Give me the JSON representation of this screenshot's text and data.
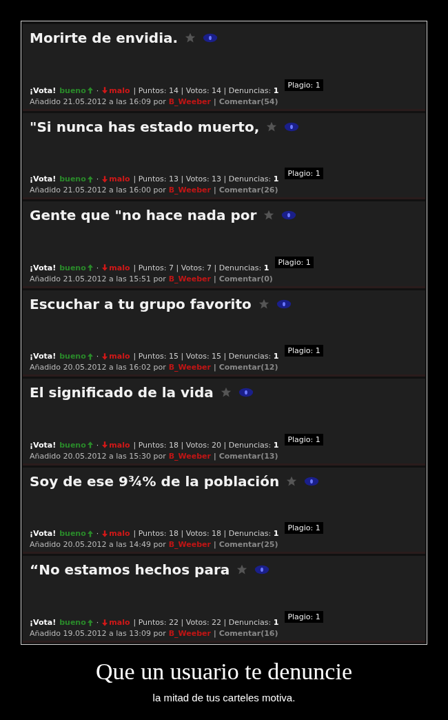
{
  "posts": [
    {
      "title": "Morirte de envidia.",
      "vote_label": "¡Vota!",
      "good": "bueno",
      "dot": "·",
      "bad": "malo",
      "stats": "| Puntos: 14 | Votos: 14 | Denuncias: **1**",
      "plagio": "Plagio: 1",
      "added": "Añadido 21.05.2012 a las 16:09 por",
      "author": "B_Weeber",
      "sep": "|",
      "comments": "Comentar(54)"
    },
    {
      "title": "\"Si nunca has estado muerto,",
      "vote_label": "¡Vota!",
      "good": "bueno",
      "dot": "·",
      "bad": "malo",
      "stats": "| Puntos: 13 | Votos: 13 | Denuncias: **1**",
      "plagio": "Plagio: 1",
      "added": "Añadido 21.05.2012 a las 16:00 por",
      "author": "B_Weeber",
      "sep": "|",
      "comments": "Comentar(26)"
    },
    {
      "title": "Gente que \"no hace nada por",
      "vote_label": "¡Vota!",
      "good": "bueno",
      "dot": "·",
      "bad": "malo",
      "stats": "| Puntos: 7 | Votos: 7 | Denuncias: **1**",
      "plagio": "Plagio: 1",
      "added": "Añadido 21.05.2012 a las 15:51 por",
      "author": "B_Weeber",
      "sep": "|",
      "comments": "Comentar(0)"
    },
    {
      "title": "Escuchar a tu grupo favorito",
      "vote_label": "¡Vota!",
      "good": "bueno",
      "dot": "·",
      "bad": "malo",
      "stats": "| Puntos: 15 | Votos: 15 | Denuncias: **1**",
      "plagio": "Plagio: 1",
      "added": "Añadido 20.05.2012 a las 16:02 por",
      "author": "B_Weeber",
      "sep": "|",
      "comments": "Comentar(12)"
    },
    {
      "title": "El significado de la vida",
      "vote_label": "¡Vota!",
      "good": "bueno",
      "dot": "·",
      "bad": "malo",
      "stats": "| Puntos: 18 | Votos: 20 | Denuncias: **1**",
      "plagio": "Plagio: 1",
      "added": "Añadido 20.05.2012 a las 15:30 por",
      "author": "B_Weeber",
      "sep": "|",
      "comments": "Comentar(13)"
    },
    {
      "title": "Soy de ese 9¾% de la población",
      "vote_label": "¡Vota!",
      "good": "bueno",
      "dot": "·",
      "bad": "malo",
      "stats": "| Puntos: 18 | Votos: 18 | Denuncias: **1**",
      "plagio": "Plagio: 1",
      "added": "Añadido 20.05.2012 a las 14:49 por",
      "author": "B_Weeber",
      "sep": "|",
      "comments": "Comentar(25)"
    },
    {
      "title": "“No estamos hechos para",
      "vote_label": "¡Vota!",
      "good": "bueno",
      "dot": "·",
      "bad": "malo",
      "stats": "| Puntos: 22 | Votos: 22 | Denuncias: **1**",
      "plagio": "Plagio: 1",
      "added": "Añadido 19.05.2012 a las 13:09 por",
      "author": "B_Weeber",
      "sep": "|",
      "comments": "Comentar(16)"
    }
  ],
  "caption": {
    "title": "Que un usuario te denuncie",
    "subtitle": "la mitad de tus carteles motiva."
  }
}
